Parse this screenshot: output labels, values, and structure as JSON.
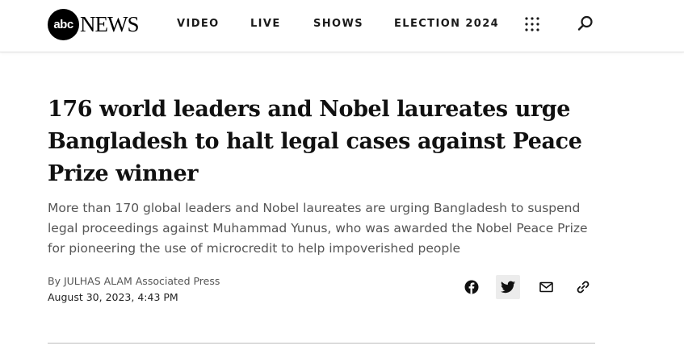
{
  "header": {
    "logo": {
      "circle_text": "abc",
      "wordmark": "NEWS"
    },
    "nav": [
      {
        "label": "VIDEO"
      },
      {
        "label": "LIVE"
      },
      {
        "label": "SHOWS"
      },
      {
        "label": "ELECTION 2024"
      }
    ],
    "icons": {
      "menu": "grid-menu-icon",
      "search": "search-icon"
    }
  },
  "article": {
    "headline": "176 world leaders and Nobel laureates urge Bangladesh to halt legal cases against Peace Prize winner",
    "dek": "More than 170 global leaders and Nobel laureates are urging Bangladesh to suspend legal proceedings against Muhammad Yunus, who was awarded the Nobel Peace Prize for pioneering the use of microcredit to help impoverished people",
    "byline": {
      "prefix": "By",
      "author": "JULHAS ALAM",
      "source": "Associated Press"
    },
    "date": "August 30, 2023, 4:43 PM"
  },
  "share": {
    "icons": [
      "facebook-icon",
      "twitter-icon",
      "email-icon",
      "link-icon"
    ]
  },
  "colors": {
    "text": "#111111",
    "muted": "#555555",
    "share_highlight": "#ececec"
  }
}
